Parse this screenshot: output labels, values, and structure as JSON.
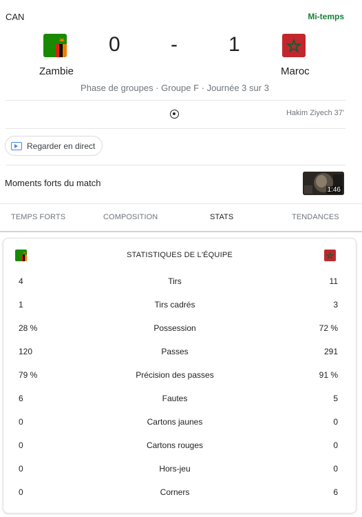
{
  "header": {
    "competition": "CAN",
    "status": "Mi-temps"
  },
  "match": {
    "home": {
      "name": "Zambie",
      "score": "0"
    },
    "away": {
      "name": "Maroc",
      "score": "1"
    },
    "separator": "-",
    "phase": "Phase de groupes · Groupe F · Journée 3 sur 3",
    "goal_event": "Hakim Ziyech 37'"
  },
  "live": {
    "label": "Regarder en direct"
  },
  "highlights": {
    "title": "Moments forts du match",
    "duration": "1:46"
  },
  "tabs": [
    {
      "label": "TEMPS FORTS",
      "active": false
    },
    {
      "label": "COMPOSITION",
      "active": false
    },
    {
      "label": "STATS",
      "active": true
    },
    {
      "label": "TENDANCES",
      "active": false
    }
  ],
  "stats": {
    "title": "STATISTIQUES DE L'ÉQUIPE",
    "rows": [
      {
        "label": "Tirs",
        "home": "4",
        "away": "11"
      },
      {
        "label": "Tirs cadrés",
        "home": "1",
        "away": "3"
      },
      {
        "label": "Possession",
        "home": "28 %",
        "away": "72 %"
      },
      {
        "label": "Passes",
        "home": "120",
        "away": "291"
      },
      {
        "label": "Précision des passes",
        "home": "79 %",
        "away": "91 %"
      },
      {
        "label": "Fautes",
        "home": "6",
        "away": "5"
      },
      {
        "label": "Cartons jaunes",
        "home": "0",
        "away": "0"
      },
      {
        "label": "Cartons rouges",
        "home": "0",
        "away": "0"
      },
      {
        "label": "Hors-jeu",
        "home": "0",
        "away": "0"
      },
      {
        "label": "Corners",
        "home": "0",
        "away": "6"
      }
    ]
  },
  "colors": {
    "status_green": "#188038",
    "zambia_green": "#198a00",
    "zambia_red": "#de2010",
    "zambia_orange": "#ef7d00",
    "morocco_red": "#c1272d",
    "morocco_star": "#006233"
  },
  "icons": {
    "live": "play-screen-icon",
    "goal": "soccer-ball-icon"
  }
}
